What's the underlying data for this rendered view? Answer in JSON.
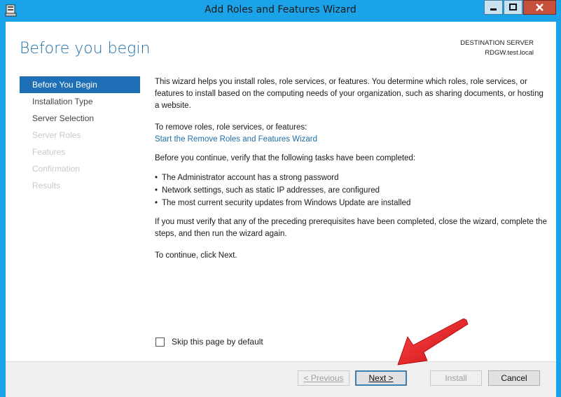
{
  "window": {
    "title": "Add Roles and Features Wizard",
    "icon": "server-manager-icon"
  },
  "header": {
    "page_title": "Before you begin",
    "destination_label": "DESTINATION SERVER",
    "destination_server": "RDGW.test.local"
  },
  "nav": {
    "items": [
      {
        "label": "Before You Begin",
        "state": "active"
      },
      {
        "label": "Installation Type",
        "state": "enabled"
      },
      {
        "label": "Server Selection",
        "state": "enabled"
      },
      {
        "label": "Server Roles",
        "state": "disabled"
      },
      {
        "label": "Features",
        "state": "disabled"
      },
      {
        "label": "Confirmation",
        "state": "disabled"
      },
      {
        "label": "Results",
        "state": "disabled"
      }
    ]
  },
  "content": {
    "intro": "This wizard helps you install roles, role services, or features. You determine which roles, role services, or features to install based on the computing needs of your organization, such as sharing documents, or hosting a website.",
    "remove_label": "To remove roles, role services, or features:",
    "remove_link": "Start the Remove Roles and Features Wizard",
    "verify_text": "Before you continue, verify that the following tasks have been completed:",
    "tasks": [
      "The Administrator account has a strong password",
      "Network settings, such as static IP addresses, are configured",
      "The most current security updates from Windows Update are installed"
    ],
    "prereq_text": "If you must verify that any of the preceding prerequisites have been completed, close the wizard, complete the steps, and then run the wizard again.",
    "continue_text": "To continue, click Next."
  },
  "skip": {
    "label": "Skip this page by default",
    "checked": false
  },
  "footer": {
    "previous_label": "< Previous",
    "next_label": "Next >",
    "install_label": "Install",
    "cancel_label": "Cancel"
  },
  "colors": {
    "accent": "#1e6fb5",
    "title_blue": "#1e6fa8",
    "frame": "#1aa3e8",
    "arrow_red": "#e8151b"
  }
}
